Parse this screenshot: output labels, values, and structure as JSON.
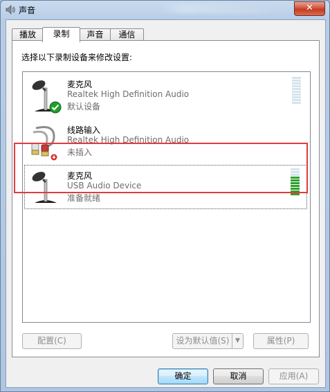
{
  "window": {
    "title": "声音",
    "close_label": "✕"
  },
  "tabs": [
    {
      "label": "播放",
      "active": false
    },
    {
      "label": "录制",
      "active": true
    },
    {
      "label": "声音",
      "active": false
    },
    {
      "label": "通信",
      "active": false
    }
  ],
  "instruction": "选择以下录制设备来修改设置:",
  "devices": [
    {
      "name": "麦克风",
      "description": "Realtek High Definition Audio",
      "status": "默认设备",
      "icon": "microphone-icon",
      "badge": "default-check-icon",
      "level": 0,
      "selected": false
    },
    {
      "name": "线路输入",
      "description": "Realtek High Definition Audio",
      "status": "未插入",
      "icon": "line-in-cable-icon",
      "badge": "unplugged-icon",
      "level": 0,
      "selected": false
    },
    {
      "name": "麦克风",
      "description": "USB Audio Device",
      "status": "准备就绪",
      "icon": "microphone-icon",
      "level": 0.7,
      "selected": true
    }
  ],
  "buttons": {
    "configure": "配置(C)",
    "set_default": "设为默认值(S)",
    "properties": "属性(P)",
    "ok": "确定",
    "cancel": "取消",
    "apply": "应用(A)"
  },
  "colors": {
    "highlight": "#e23b3b",
    "meter_on": "#2f9f2f",
    "meter_off": "#d6e4ec"
  }
}
